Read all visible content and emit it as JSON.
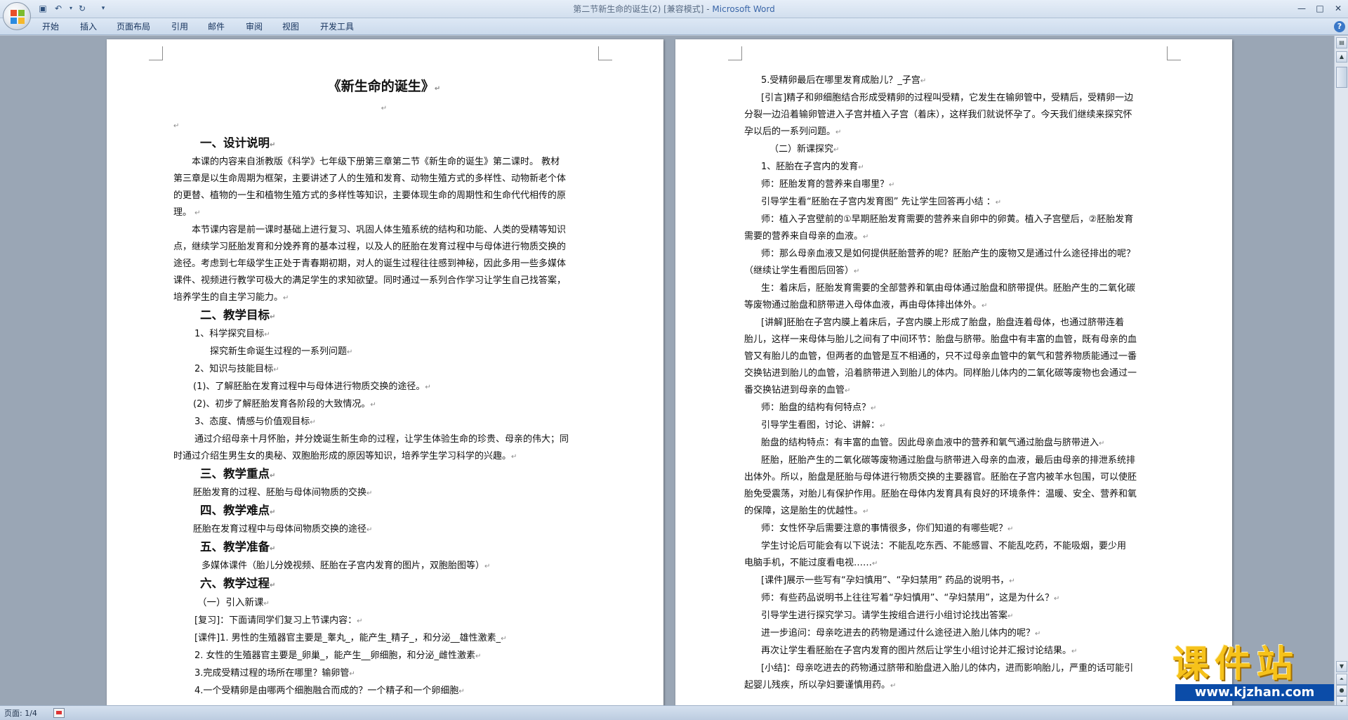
{
  "window": {
    "title_doc": "第二节新生命的诞生(2) [兼容模式] - ",
    "title_app": "Microsoft Word",
    "controls": [
      "—",
      "□",
      "✕"
    ]
  },
  "ribbon": {
    "tabs": [
      "开始",
      "插入",
      "页面布局",
      "引用",
      "邮件",
      "审阅",
      "视图",
      "开发工具"
    ],
    "help": "?"
  },
  "status": {
    "page": "页面: 1/4"
  },
  "page1": {
    "title": "《新生命的诞生》",
    "h_design": "一、设计说明",
    "design_p1": [
      "本课的内容来自浙教版《科学》七年级下册第三章第二节《新生命的诞生》第二课时。 教材",
      "第三章是以生命周期为框架，主要讲述了人的生殖和发育、动物生殖方式的多样性、动物新老个体",
      "的更替、植物的一生和植物生殖方式的多样性等知识，主要体现生命的周期性和生命代代相传的原",
      "理。"
    ],
    "design_p2": [
      "本节课内容是前一课时基础上进行复习、巩固人体生殖系统的结构和功能、人类的受精等知识",
      "点，继续学习胚胎发育和分娩养育的基本过程，以及人的胚胎在发育过程中与母体进行物质交换的",
      "途径。考虑到七年级学生正处于青春期初期，对人的诞生过程往往感到神秘，因此多用一些多媒体",
      "课件、视频进行教学可极大的满足学生的求知欲望。同时通过一系列合作学习让学生自己找答案，",
      "培养学生的自主学习能力。"
    ],
    "h_goal": "二、教学目标",
    "goal_1": "1、科学探究目标",
    "goal_1_text": "探究新生命诞生过程的一系列问题",
    "goal_2": "2、知识与技能目标",
    "goal_2_a": "(1)、了解胚胎在发育过程中与母体进行物质交换的途径。",
    "goal_2_b": "(2)、初步了解胚胎发育各阶段的大致情况。",
    "goal_3": "3、态度、情感与价值观目标",
    "goal_3_text": [
      "通过介绍母亲十月怀胎，并分娩诞生新生命的过程，让学生体验生命的珍贵、母亲的伟大；同",
      "时通过介绍生男生女的奥秘、双胞胎形成的原因等知识，培养学生学习科学的兴趣。"
    ],
    "h_key": "三、教学重点",
    "key_text": "胚胎发育的过程、胚胎与母体间物质的交换",
    "h_diff": "四、教学难点",
    "diff_text": "胚胎在发育过程中与母体间物质交换的途径",
    "h_prep": "五、教学准备",
    "prep_text": "多媒体课件（胎儿分娩视频、胚胎在子宫内发育的图片，双胞胎图等）",
    "h_proc": "六、教学过程",
    "proc_1": "（一）引入新课",
    "review": "[复习]：下面请同学们复习上节课内容：",
    "q1": "[课件]1. 男性的生殖器官主要是_睾丸_，能产生_精子_，和分泌__雄性激素_",
    "q2": "2. 女性的生殖器官主要是_卵巢_，能产生__卵细胞，和分泌_雌性激素",
    "q3": "3.完成受精过程的场所在哪里？输卵管",
    "q4": "4.一个受精卵是由哪两个细胞融合而成的？一个精子和一个卵细胞"
  },
  "page2": {
    "lines": [
      "5.受精卵最后在哪里发育成胎儿？_子宫",
      "[引言]精子和卵细胞结合形成受精卵的过程叫受精，它发生在输卵管中，受精后，受精卵一边",
      "分裂一边沿着输卵管进入子宫并植入子宫（着床），这样我们就说怀孕了。今天我们继续来探究怀",
      "孕以后的一系列问题。",
      "（二）新课探究",
      "1、胚胎在子宫内的发育",
      "师：胚胎发育的营养来自哪里？",
      "引导学生看“胚胎在子宫内发育图” 先让学生回答再小结 ：",
      "师：植入子宫壁前的①早期胚胎发育需要的营养来自卵中的卵黄。植入子宫壁后，②胚胎发育",
      "需要的营养来自母亲的血液。",
      "师：那么母亲血液又是如何提供胚胎营养的呢？胚胎产生的废物又是通过什么途径排出的呢？",
      "（继续让学生看图后回答）",
      "生：着床后，胚胎发育需要的全部营养和氧由母体通过胎盘和脐带提供。胚胎产生的二氧化碳",
      "等废物通过胎盘和脐带进入母体血液，再由母体排出体外。",
      "[讲解]胚胎在子宫内膜上着床后，子宫内膜上形成了胎盘，胎盘连着母体，也通过脐带连着",
      "胎儿，这样一来母体与胎儿之间有了中间环节：胎盘与脐带。胎盘中有丰富的血管，既有母亲的血",
      "管又有胎儿的血管，但两者的血管是互不相通的，只不过母亲血管中的氧气和营养物质能通过一番",
      "交换钻进到胎儿的血管，沿着脐带进入到胎儿的体内。同样胎儿体内的二氧化碳等废物也会通过一",
      "番交换钻进到母亲的血管",
      "师：胎盘的结构有何特点？",
      "引导学生看图，讨论、讲解：",
      "胎盘的结构特点：有丰富的血管。因此母亲血液中的营养和氧气通过胎盘与脐带进入",
      "胚胎，胚胎产生的二氧化碳等废物通过胎盘与脐带进入母亲的血液，最后由母亲的排泄系统排",
      "出体外。所以，胎盘是胚胎与母体进行物质交换的主要器官。胚胎在子宫内被羊水包围，可以使胚",
      "胎免受震荡，对胎儿有保护作用。胚胎在母体内发育具有良好的环境条件：温暖、安全、营养和氧",
      "的保障，这是胎生的优越性。",
      "师：女性怀孕后需要注意的事情很多，你们知道的有哪些呢？",
      "学生讨论后可能会有以下说法：不能乱吃东西、不能感冒、不能乱吃药，不能吸烟，要少用",
      "电脑手机，不能过度看电视……",
      "[课件]展示一些写有“孕妇慎用”、“孕妇禁用” 药品的说明书，",
      "师：有些药品说明书上往往写着“孕妇慎用”、“孕妇禁用”，这是为什么？",
      "引导学生进行探究学习。请学生按组合进行小组讨论找出答案",
      "进一步追问：母亲吃进去的药物是通过什么途径进入胎儿体内的呢？",
      "再次让学生看胚胎在子宫内发育的图片然后让学生小组讨论并汇报讨论结果。",
      "[小结]：母亲吃进去的药物通过脐带和胎盘进入胎儿的体内，进而影响胎儿，严重的话可能引",
      "起婴儿残疾，所以孕妇要谨慎用药。"
    ]
  },
  "watermark": {
    "title": "课件站",
    "url": "www.kjzhan.com"
  }
}
